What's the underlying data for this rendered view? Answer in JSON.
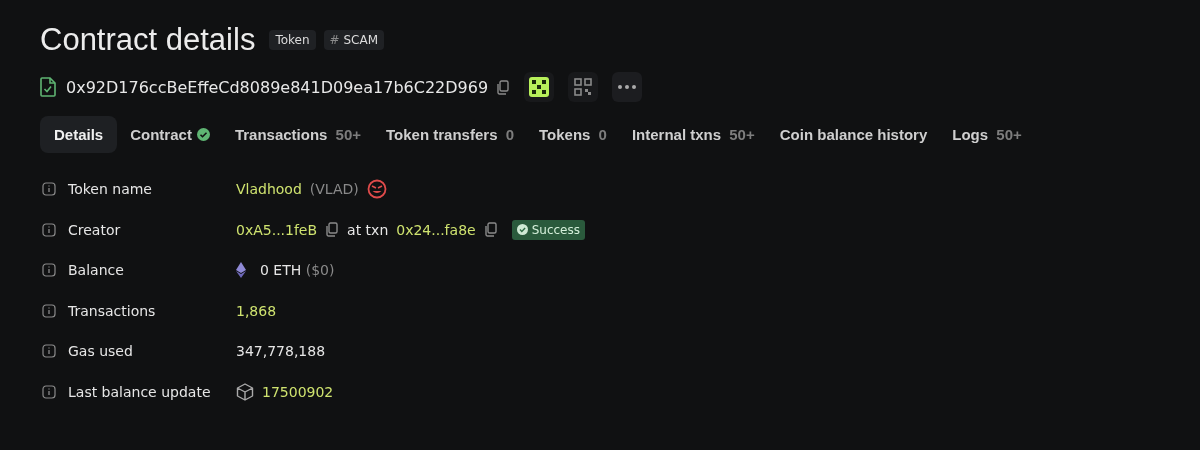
{
  "header": {
    "title": "Contract details",
    "tags": [
      {
        "kind": "plain",
        "label": "Token"
      },
      {
        "kind": "hash",
        "symbol": "#",
        "label": "SCAM"
      }
    ]
  },
  "address": {
    "value": "0x92D176ccBeEffeCd8089e841D09ea17b6C22D969"
  },
  "tabs": [
    {
      "label": "Details",
      "selected": true
    },
    {
      "label": "Contract",
      "verified": true,
      "selected": false
    },
    {
      "label": "Transactions",
      "count": "50+",
      "selected": false
    },
    {
      "label": "Token transfers",
      "count": "0",
      "selected": false
    },
    {
      "label": "Tokens",
      "count": "0",
      "selected": false
    },
    {
      "label": "Internal txns",
      "count": "50+",
      "selected": false
    },
    {
      "label": "Coin balance history",
      "selected": false
    },
    {
      "label": "Logs",
      "count": "50+",
      "selected": false
    }
  ],
  "details": [
    {
      "kind": "token",
      "label": "Token name",
      "name": "Vladhood",
      "symbol": "(VLAD)"
    },
    {
      "kind": "creator",
      "label": "Creator",
      "address": "0xA5...1feB",
      "connector": "at txn",
      "txn": "0x24...fa8e",
      "status": "Success"
    },
    {
      "kind": "balance",
      "label": "Balance",
      "amount": "0 ETH",
      "usd": "($0)"
    },
    {
      "kind": "link",
      "label": "Transactions",
      "value": "1,868"
    },
    {
      "kind": "plain",
      "label": "Gas used",
      "value": "347,778,188"
    },
    {
      "kind": "block",
      "label": "Last balance update",
      "value": "17500902"
    }
  ]
}
